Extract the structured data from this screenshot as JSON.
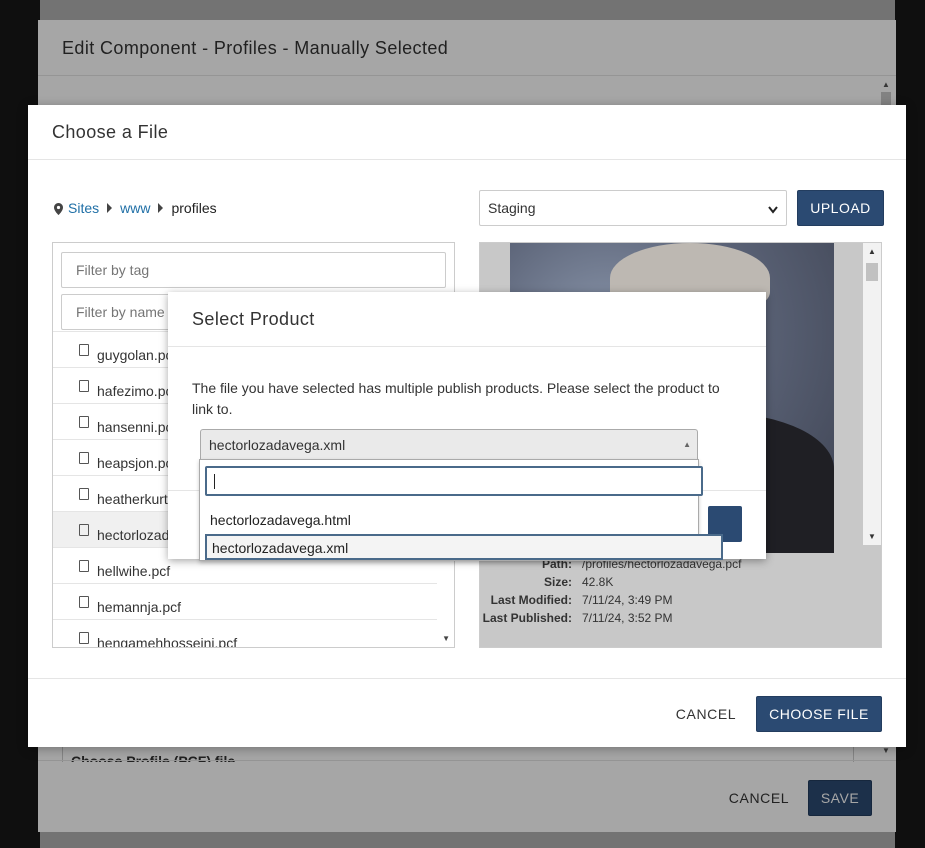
{
  "edit_modal": {
    "title": "Edit Component - Profiles - Manually Selected",
    "field_peek": "Choose Profile (PCF) file",
    "cancel_label": "CANCEL",
    "save_label": "SAVE"
  },
  "choose_modal": {
    "title": "Choose a File",
    "breadcrumb": [
      "Sites",
      "www",
      "profiles"
    ],
    "environment": "Staging",
    "upload_label": "UPLOAD",
    "filter_tag_placeholder": "Filter by tag",
    "filter_name_placeholder": "Filter by name",
    "files": [
      "guygolan.pcf",
      "hafezimo.pcf",
      "hansenni.pcf",
      "heapsjon.pcf",
      "heatherkurt.pcf",
      "hectorlozadavega.pcf",
      "hellwihe.pcf",
      "hemannja.pcf",
      "hengamehhosseini.pcf"
    ],
    "selected_file_index": 5,
    "meta": {
      "path_label": "Path:",
      "path": "/profiles/hectorlozadavega.pcf",
      "size_label": "Size:",
      "size": "42.8K",
      "modified_label": "Last Modified:",
      "modified": "7/11/24, 3:49 PM",
      "published_label": "Last Published:",
      "published": "7/11/24, 3:52 PM"
    },
    "cancel_label": "CANCEL",
    "choose_label": "CHOOSE FILE"
  },
  "product_modal": {
    "title": "Select Product",
    "message": "The file you have selected has multiple publish products. Please select the product to link to.",
    "selected": "hectorlozadavega.xml",
    "search_value": "",
    "options": [
      "hectorlozadavega.html",
      "hectorlozadavega.xml"
    ],
    "highlighted_index": 1
  },
  "colors": {
    "primary": "#2b4a72",
    "link": "#1f6fa6"
  }
}
